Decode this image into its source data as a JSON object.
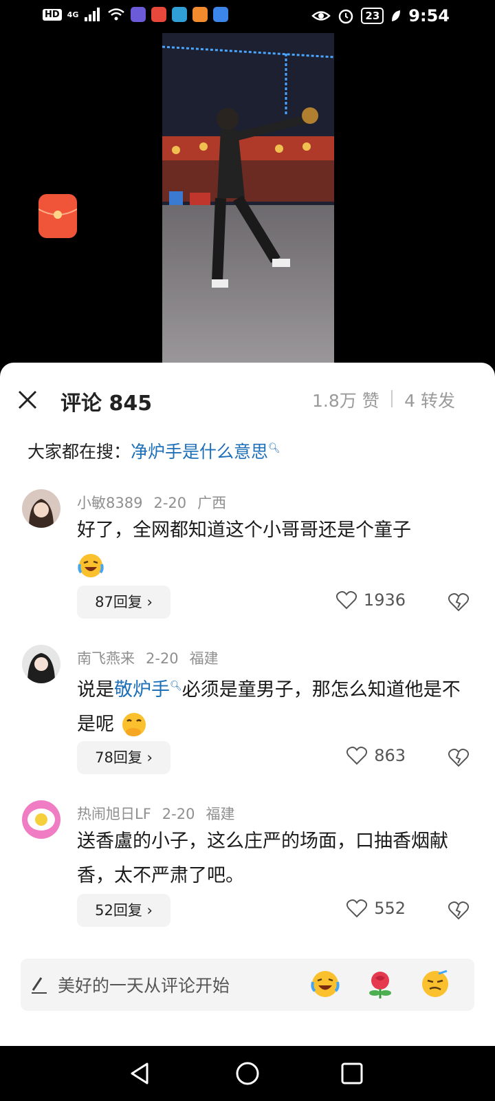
{
  "status_bar": {
    "hd": "HD",
    "network": "4G",
    "time": "9:54",
    "battery": "23"
  },
  "comments_header": {
    "title": "评论 845",
    "likes": "1.8万 赞",
    "separator": "|",
    "shares": "4 转发"
  },
  "search_suggest": {
    "label": "大家都在搜：",
    "query": "净炉手是什么意思"
  },
  "comments": [
    {
      "user": "小敏8389",
      "date": "2-20",
      "region": "广西",
      "text": "好了，全网都知道这个小哥哥还是个童子",
      "emoji": "laughing-crying-emoji",
      "replies": "87回复",
      "likes": "1936"
    },
    {
      "user": "南飞燕来",
      "date": "2-20",
      "region": "福建",
      "text_before": "说是",
      "text_link": "敬炉手",
      "text_after": "必须是童男子，那怎么知道他是不是呢",
      "emoji": "hand-over-mouth-emoji",
      "replies": "78回复",
      "likes": "863"
    },
    {
      "user": "热闹旭日LF",
      "date": "2-20",
      "region": "福建",
      "text": "送香盧的小子，这么庄严的场面，口抽香烟献香，太不严肃了吧。",
      "replies": "52回复",
      "likes": "552"
    }
  ],
  "input_bar": {
    "placeholder": "美好的一天从评论开始",
    "emojis": [
      "laughing-crying-emoji",
      "rose-emoji",
      "sly-emoji"
    ]
  },
  "colors": {
    "link": "#1d6fb8",
    "meta_text": "#8f8f8f",
    "sheet_bg": "#ffffff",
    "red_packet": "#f0553a"
  }
}
